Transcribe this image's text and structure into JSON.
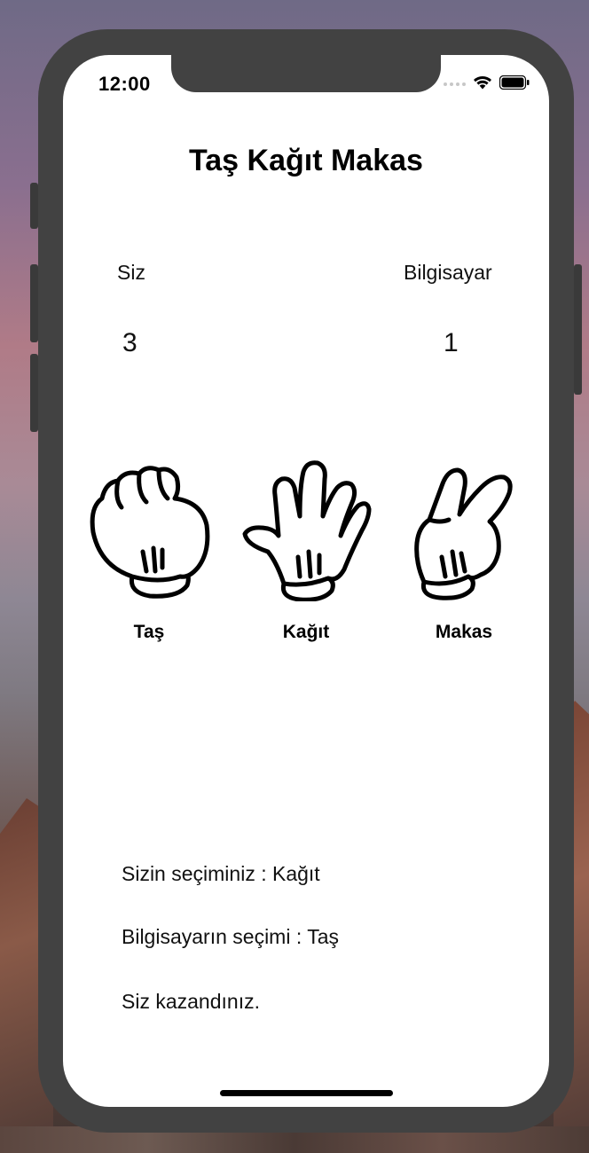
{
  "status_bar": {
    "time": "12:00",
    "icons": [
      "signal-icon",
      "wifi-icon",
      "battery-icon"
    ]
  },
  "app": {
    "title": "Taş Kağıt Makas"
  },
  "scoreboard": {
    "player_label": "Siz",
    "computer_label": "Bilgisayar",
    "player_score": "3",
    "computer_score": "1"
  },
  "choices": [
    {
      "label": "Taş",
      "icon": "rock-hand-icon"
    },
    {
      "label": "Kağıt",
      "icon": "paper-hand-icon"
    },
    {
      "label": "Makas",
      "icon": "scissors-hand-icon"
    }
  ],
  "result": {
    "player_choice": "Sizin seçiminiz : Kağıt",
    "computer_choice": "Bilgisayarın seçimi : Taş",
    "outcome": "Siz kazandınız."
  }
}
